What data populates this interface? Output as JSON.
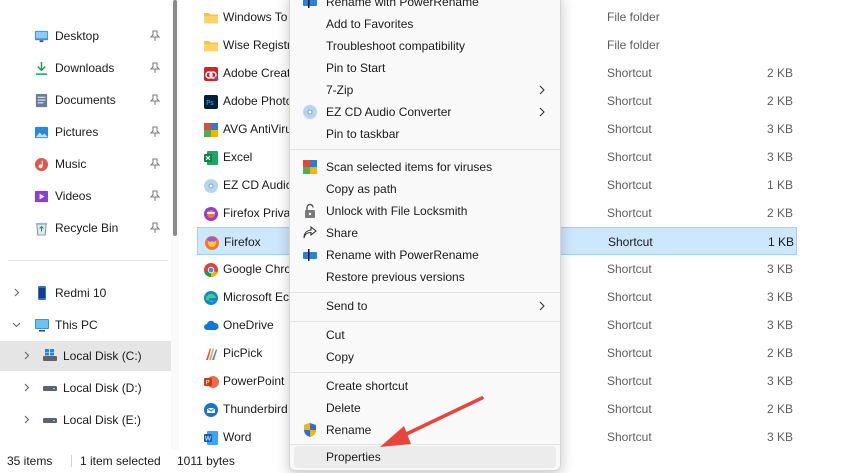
{
  "sidebar": {
    "quick_access": [
      {
        "label": "Desktop",
        "icon": "desktop-icon"
      },
      {
        "label": "Downloads",
        "icon": "downloads-icon"
      },
      {
        "label": "Documents",
        "icon": "documents-icon"
      },
      {
        "label": "Pictures",
        "icon": "pictures-icon"
      },
      {
        "label": "Music",
        "icon": "music-icon"
      },
      {
        "label": "Videos",
        "icon": "videos-icon"
      },
      {
        "label": "Recycle Bin",
        "icon": "recycle-bin-icon"
      }
    ],
    "tree": [
      {
        "label": "Redmi 10",
        "icon": "phone-icon"
      },
      {
        "label": "This PC",
        "icon": "this-pc-icon"
      },
      {
        "label": "Local Disk (C:)",
        "icon": "windows-drive-icon"
      },
      {
        "label": "Local Disk (D:)",
        "icon": "drive-icon"
      },
      {
        "label": "Local Disk (E:)",
        "icon": "drive-icon"
      }
    ]
  },
  "files": [
    {
      "name": "Windows To",
      "type": "",
      "size": ""
    },
    {
      "name": "Wise Registr",
      "type": "File folder",
      "size": ""
    },
    {
      "name": "Adobe Creat",
      "type": "Shortcut",
      "size": "2 KB"
    },
    {
      "name": "Adobe Photo",
      "type": "Shortcut",
      "size": "2 KB"
    },
    {
      "name": "AVG AntiViru",
      "type": "Shortcut",
      "size": "3 KB"
    },
    {
      "name": "Excel",
      "type": "Shortcut",
      "size": "3 KB"
    },
    {
      "name": "EZ CD Audic",
      "type": "Shortcut",
      "size": "1 KB"
    },
    {
      "name": "Firefox Priva",
      "type": "Shortcut",
      "size": "2 KB"
    },
    {
      "name": "Firefox",
      "type": "Shortcut",
      "size": "1 KB"
    },
    {
      "name": "Google Chro",
      "type": "Shortcut",
      "size": "3 KB"
    },
    {
      "name": "Microsoft Ec",
      "type": "Shortcut",
      "size": "3 KB"
    },
    {
      "name": "OneDrive",
      "type": "Shortcut",
      "size": "3 KB"
    },
    {
      "name": "PicPick",
      "type": "Shortcut",
      "size": "2 KB"
    },
    {
      "name": "PowerPoint",
      "type": "Shortcut",
      "size": "3 KB"
    },
    {
      "name": "Thunderbird",
      "type": "Shortcut",
      "size": "2 KB"
    },
    {
      "name": "Word",
      "type": "Shortcut",
      "size": "3 KB"
    }
  ],
  "first_row_type": "File folder",
  "statusbar": {
    "count": "35 items",
    "selected": "1 item selected",
    "size": "1011 bytes"
  },
  "context_menu": {
    "items": [
      {
        "label": "Rename with PowerRename",
        "icon": "powerrename-icon"
      },
      {
        "label": "Add to Favorites",
        "icon": ""
      },
      {
        "label": "Troubleshoot compatibility",
        "icon": ""
      },
      {
        "label": "Pin to Start",
        "icon": ""
      },
      {
        "label": "7-Zip",
        "icon": "",
        "submenu": true
      },
      {
        "label": "EZ CD Audio Converter",
        "icon": "cd-icon",
        "submenu": true
      },
      {
        "label": "Pin to taskbar",
        "icon": ""
      },
      {
        "label": "Scan selected items for viruses",
        "icon": "avg-shield-icon"
      },
      {
        "label": "Copy as path",
        "icon": ""
      },
      {
        "label": "Unlock with File Locksmith",
        "icon": "lock-icon"
      },
      {
        "label": "Share",
        "icon": "share-icon"
      },
      {
        "label": "Rename with PowerRename",
        "icon": "powerrename-icon"
      },
      {
        "label": "Restore previous versions",
        "icon": ""
      },
      {
        "label": "Send to",
        "icon": "",
        "submenu": true
      },
      {
        "label": "Cut",
        "icon": ""
      },
      {
        "label": "Copy",
        "icon": ""
      },
      {
        "label": "Create shortcut",
        "icon": ""
      },
      {
        "label": "Delete",
        "icon": ""
      },
      {
        "label": "Rename",
        "icon": "uac-shield-icon"
      },
      {
        "label": "Properties",
        "icon": ""
      }
    ]
  },
  "colors": {
    "selection_bg": "#cce8ff",
    "selection_border": "#99d1ff",
    "annotation_arrow": "#e8453c"
  }
}
